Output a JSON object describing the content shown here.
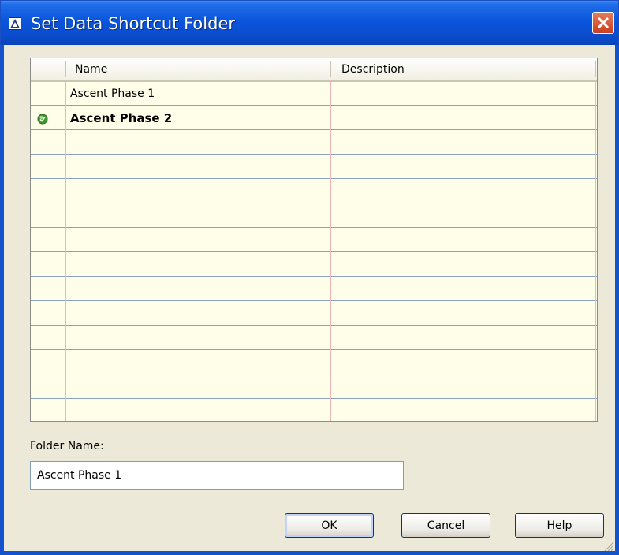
{
  "window": {
    "title": "Set Data Shortcut Folder"
  },
  "table": {
    "columns": [
      "Name",
      "Description"
    ],
    "rows": [
      {
        "name": "Ascent Phase 1",
        "description": "",
        "current": false
      },
      {
        "name": "Ascent Phase 2",
        "description": "",
        "current": true
      }
    ]
  },
  "folder": {
    "label": "Folder Name:",
    "value": "Ascent Phase 1"
  },
  "buttons": {
    "ok": "OK",
    "cancel": "Cancel",
    "help": "Help"
  },
  "icons": {
    "app": "autocad-app-icon",
    "close": "close-icon",
    "current_marker": "green-check-icon",
    "resize": "resize-grip-icon"
  },
  "colors": {
    "titlebar": "#0a55dc",
    "close_button": "#cc3e1d",
    "grid_background": "#fffee8",
    "row_lines": "#8aa3c4",
    "column_lines": "#f0b4b4",
    "check": "#3e9a2e"
  }
}
